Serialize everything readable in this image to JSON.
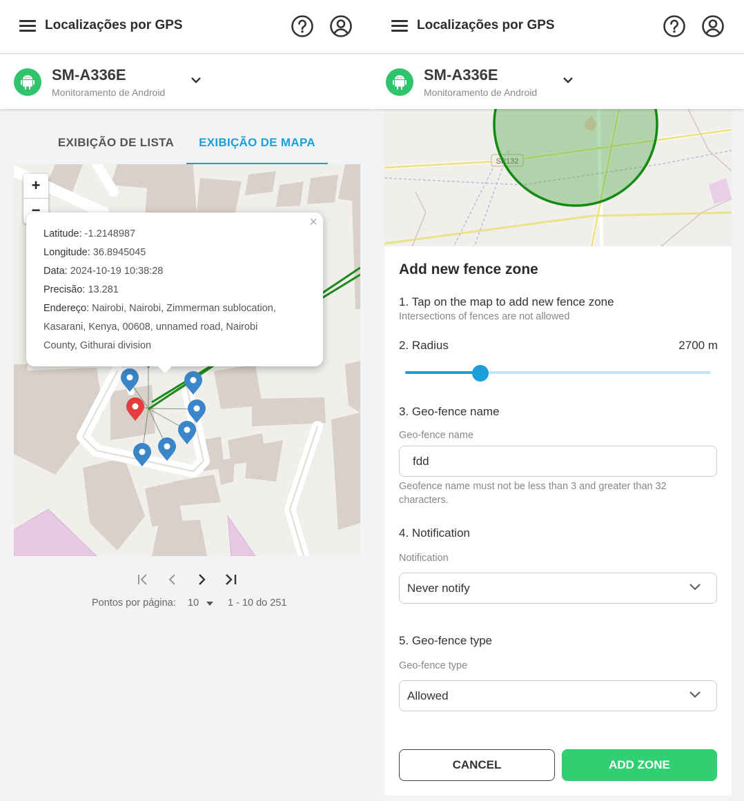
{
  "header": {
    "title": "Localizações por GPS",
    "help_icon": "help-circle-icon",
    "account_icon": "account-circle-icon"
  },
  "device": {
    "name": "SM-A336E",
    "subtitle": "Monitoramento de Android",
    "icon": "android-icon"
  },
  "tabs": [
    {
      "label": "EXIBIÇÃO DE LISTA",
      "active": false
    },
    {
      "label": "EXIBIÇÃO DE MAPA",
      "active": true
    }
  ],
  "map": {
    "zoom_in": "+",
    "zoom_out": "−",
    "popup": {
      "close": "×",
      "latitude_label": "Latitude:",
      "latitude": "-1.2148987",
      "longitude_label": "Longitude:",
      "longitude": "36.8945045",
      "date_label": "Data:",
      "date": "2024-10-19 10:38:28",
      "precision_label": "Precisão:",
      "precision": "13.281",
      "address_label": "Endereço:",
      "address_line1": "Nairobi, Nairobi, Zimmerman sublocation,",
      "address_line2": "Kasarani, Kenya, 00608, unnamed road, Nairobi",
      "address_line3": "County, Githurai division"
    },
    "road_label": "SP132"
  },
  "pagination": {
    "per_page_label": "Pontos por página:",
    "per_page": "10",
    "range": "1 - 10 do 251"
  },
  "fence_form": {
    "title": "Add new fence zone",
    "step1": "1. Tap on the map to add new fence zone",
    "step1_hint": "Intersections of fences are not allowed",
    "step2": "2. Radius",
    "radius_value": "2700 m",
    "radius_fraction": 0.245,
    "step3": "3. Geo-fence name",
    "name_label": "Geo-fence name",
    "name_value": "fdd",
    "name_helper": "Geofence name must not be less than 3 and greater than 32 characters.",
    "step4": "4. Notification",
    "notification_label": "Notification",
    "notification_value": "Never notify",
    "step5": "5. Geo-fence type",
    "type_label": "Geo-fence type",
    "type_value": "Allowed",
    "cancel": "CANCEL",
    "add": "ADD ZONE"
  },
  "colors": {
    "accent": "#1a9fd9",
    "brand_green": "#2fc46b",
    "button_green": "#2fcf72",
    "marker_blue": "#3a86c8",
    "marker_red": "#e43d3d",
    "fence_green": "#138a13"
  }
}
